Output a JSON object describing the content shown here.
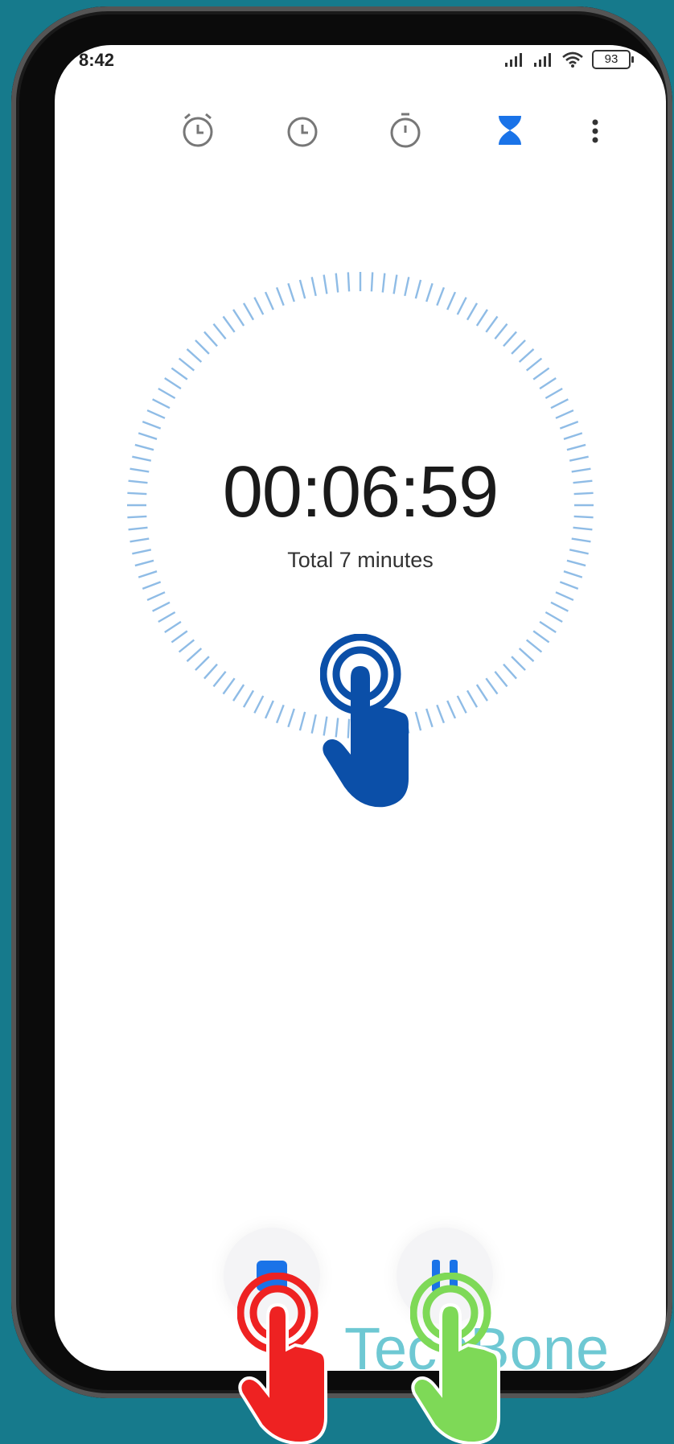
{
  "status_bar": {
    "time": "8:42",
    "battery": "93"
  },
  "tabs": [
    {
      "icon": "alarm-icon"
    },
    {
      "icon": "world-clock-icon"
    },
    {
      "icon": "stopwatch-icon"
    },
    {
      "icon": "timer-icon",
      "active": true
    }
  ],
  "timer": {
    "remaining": "00:06:59",
    "total": "Total 7 minutes"
  },
  "controls": {
    "stop_icon": "stop-icon",
    "pause_icon": "pause-icon"
  },
  "watermark": "TechBone",
  "colors": {
    "accent": "#1a73e8",
    "ring": "#8fbce6",
    "hand_blue": "#0b4fa8",
    "hand_red": "#ee2222",
    "hand_green": "#7ed957",
    "background": "#167a8c"
  }
}
